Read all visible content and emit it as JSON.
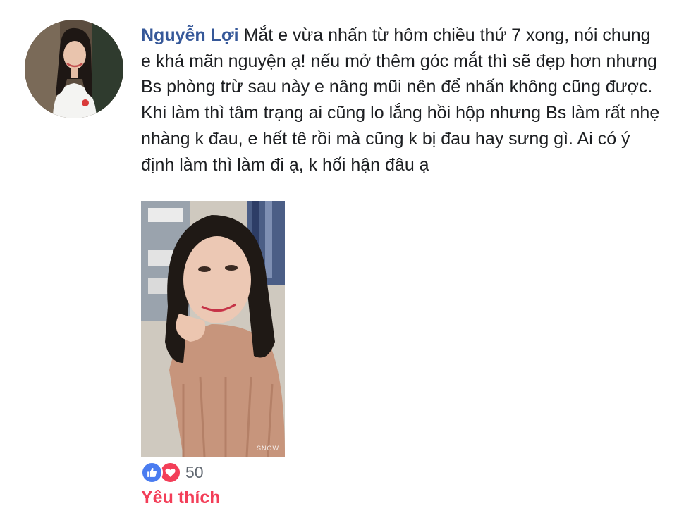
{
  "comment": {
    "author": "Nguyễn Lợi",
    "text": "Mắt e vừa nhấn từ hôm chiều thứ 7 xong, nói chung e khá mãn nguyện ạ! nếu mở thêm góc mắt thì sẽ đẹp hơn nhưng Bs phòng trừ sau này e nâng mũi nên để nhấn không cũng được. Khi làm thì tâm trạng ai cũng lo lắng hồi hộp nhưng Bs làm rất nhẹ nhàng k đau, e hết tê rồi mà cũng k bị đau hay sưng gì. Ai có ý định làm thì làm đi ạ, k hối hận đâu ạ",
    "photo_watermark": "SNOW"
  },
  "reactions": {
    "icons": [
      "like-icon",
      "love-icon"
    ],
    "count": "50"
  },
  "action": {
    "label": "Yêu thích"
  },
  "colors": {
    "author": "#365899",
    "like": "#4a7cf0",
    "love": "#f33e58",
    "action_active": "#f33e58"
  }
}
